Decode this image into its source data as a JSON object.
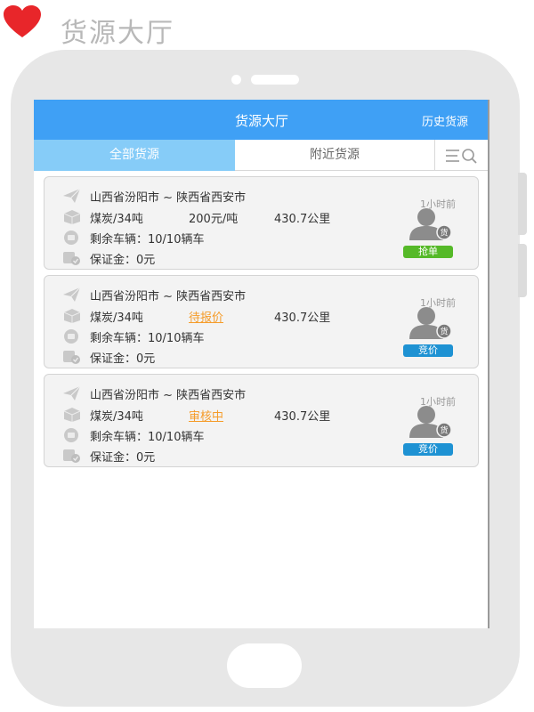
{
  "page": {
    "heading": "货源大厅"
  },
  "navbar": {
    "title": "货源大厅",
    "history_label": "历史货源"
  },
  "tabs": [
    {
      "label": "全部货源",
      "active": true
    },
    {
      "label": "附近货源",
      "active": false
    }
  ],
  "cards": [
    {
      "route": "山西省汾阳市 ~ 陕西省西安市",
      "weight": "煤炭/34吨",
      "price": "200元/吨",
      "distance": "430.7公里",
      "vehicles": "剩余车辆：10/10辆车",
      "deposit": "保证金：0元",
      "time_ago": "1小时前",
      "avatar_badge": "货",
      "action": "抢单",
      "action_color": "#55b928"
    },
    {
      "route": "山西省汾阳市 ~ 陕西省西安市",
      "weight": "煤炭/34吨",
      "price": "待报价",
      "distance": "430.7公里",
      "vehicles": "剩余车辆：10/10辆车",
      "deposit": "保证金：0元",
      "time_ago": "1小时前",
      "avatar_badge": "货",
      "action": "竞价",
      "action_color": "#1e92d3"
    },
    {
      "route": "山西省汾阳市 ~ 陕西省西安市",
      "weight": "煤炭/34吨",
      "price": "审核中",
      "distance": "430.7公里",
      "vehicles": "剩余车辆：10/10辆车",
      "deposit": "保证金：0元",
      "time_ago": "1小时前",
      "avatar_badge": "货",
      "action": "竞价",
      "action_color": "#1e92d3"
    }
  ],
  "icons": {
    "brand": "red-heart-logo-icon",
    "filter": "search-filter-icon",
    "route": "paper-plane-icon",
    "cargo": "box-icon",
    "vehicles": "remaining-badge-icon",
    "deposit": "deposit-shield-icon",
    "avatar": "user-avatar-icon"
  },
  "colors": {
    "navbar": "#3fa0f5",
    "active_tab": "#86ccf8",
    "price_pending": "#f59c2a",
    "grab_button": "#55b928",
    "bid_button": "#1e92d3"
  }
}
